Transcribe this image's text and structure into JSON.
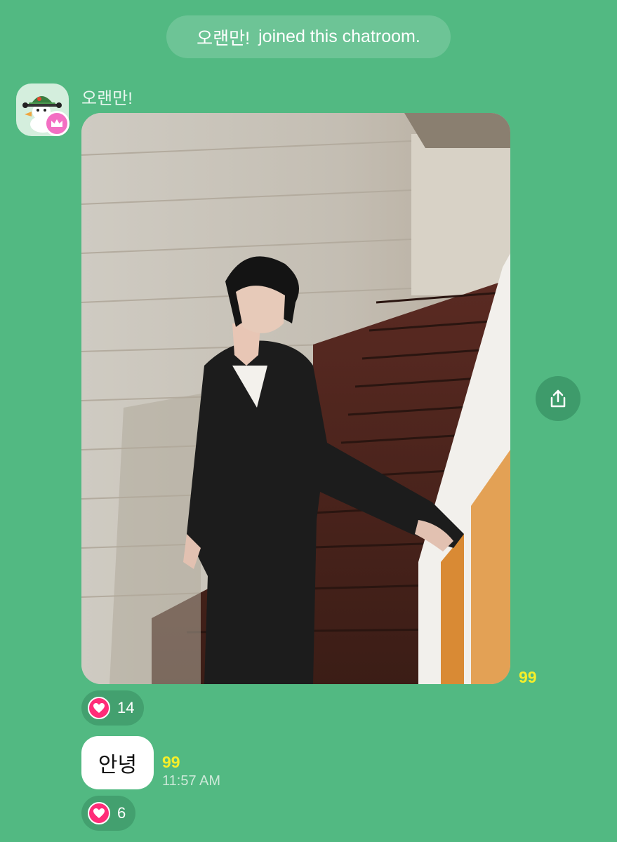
{
  "system_message": {
    "user": "오랜만!",
    "text": "joined this chatroom."
  },
  "message1": {
    "sender": "오랜만!",
    "avatar_icon": "duck-with-helmet-avatar",
    "badge_icon": "crown-icon",
    "attachment": "photo-of-person-in-black-suit-on-staircase",
    "share_icon": "share-icon",
    "read_count": "99",
    "reaction": {
      "icon": "heart-icon",
      "count": "14"
    }
  },
  "message2": {
    "text": "안녕",
    "read_count": "99",
    "time": "11:57 AM",
    "reaction": {
      "icon": "heart-icon",
      "count": "6"
    }
  },
  "colors": {
    "background": "#52b982",
    "unread_count": "#f5ef2a",
    "heart": "#ff2c78",
    "crown_badge": "#f36fc3"
  }
}
